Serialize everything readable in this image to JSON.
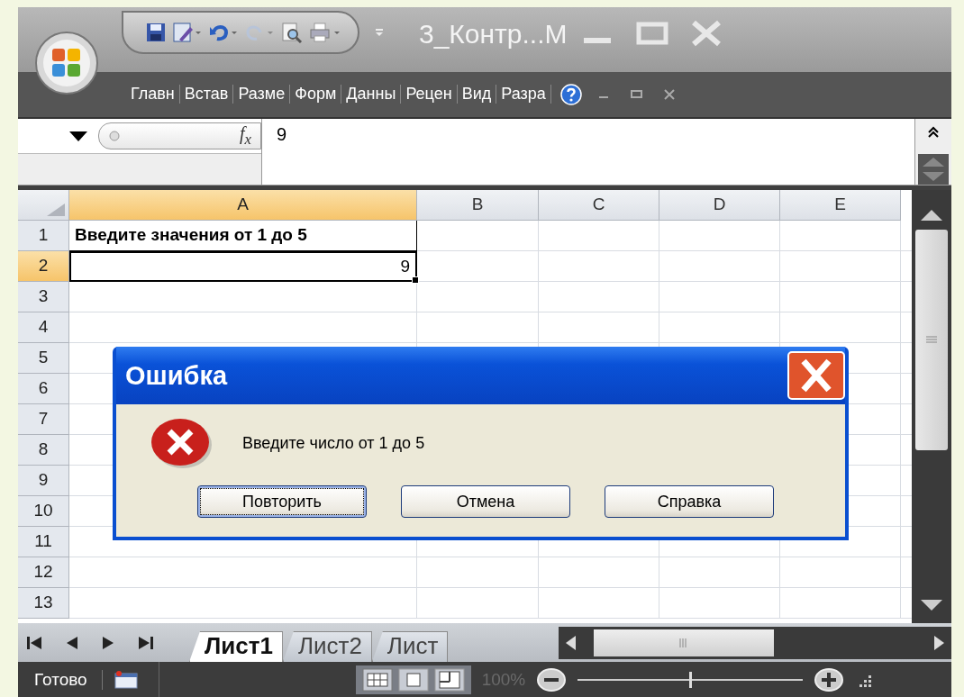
{
  "window": {
    "title": "3_Контр...М"
  },
  "ribbon_tabs": [
    {
      "label": "Главн"
    },
    {
      "label": "Встав"
    },
    {
      "label": "Разме"
    },
    {
      "label": "Форм"
    },
    {
      "label": "Данны"
    },
    {
      "label": "Рецен"
    },
    {
      "label": "Вид"
    },
    {
      "label": "Разра"
    }
  ],
  "formula_bar": {
    "function_label": "f$_{x}$",
    "value": "9"
  },
  "sheet": {
    "columns": [
      {
        "label": "A",
        "selected": true
      },
      {
        "label": "B",
        "selected": false
      },
      {
        "label": "C",
        "selected": false
      },
      {
        "label": "D",
        "selected": false
      },
      {
        "label": "E",
        "selected": false
      }
    ],
    "rows": [
      {
        "number": "1",
        "selected": false,
        "cells": [
          {
            "text": "Введите значения от 1 до 5",
            "kind": "label",
            "selected": false
          }
        ]
      },
      {
        "number": "2",
        "selected": true,
        "cells": [
          {
            "text": "9",
            "kind": "number",
            "selected": true
          }
        ]
      },
      {
        "number": "3",
        "selected": false,
        "cells": []
      },
      {
        "number": "4",
        "selected": false,
        "cells": []
      },
      {
        "number": "5",
        "selected": false,
        "cells": []
      },
      {
        "number": "6",
        "selected": false,
        "cells": []
      },
      {
        "number": "7",
        "selected": false,
        "cells": []
      },
      {
        "number": "8",
        "selected": false,
        "cells": []
      },
      {
        "number": "9",
        "selected": false,
        "cells": []
      },
      {
        "number": "10",
        "selected": false,
        "cells": []
      },
      {
        "number": "11",
        "selected": false,
        "cells": []
      },
      {
        "number": "12",
        "selected": false,
        "cells": []
      },
      {
        "number": "13",
        "selected": false,
        "cells": []
      }
    ]
  },
  "sheet_tabs": [
    {
      "label": "Лист1",
      "selected": true
    },
    {
      "label": "Лист2",
      "selected": false
    },
    {
      "label": "Лист",
      "selected": false
    }
  ],
  "status_bar": {
    "status": "Готово",
    "zoom": "100%",
    "zoom_disabled": true,
    "zoom_slider": {
      "level": 0.5
    }
  },
  "dialog": {
    "title": "Ошибка",
    "message": "Введите число от 1 до 5",
    "buttons": [
      {
        "label": "Повторить",
        "selected": true
      },
      {
        "label": "Отмена",
        "selected": false
      },
      {
        "label": "Справка",
        "selected": false
      }
    ]
  }
}
